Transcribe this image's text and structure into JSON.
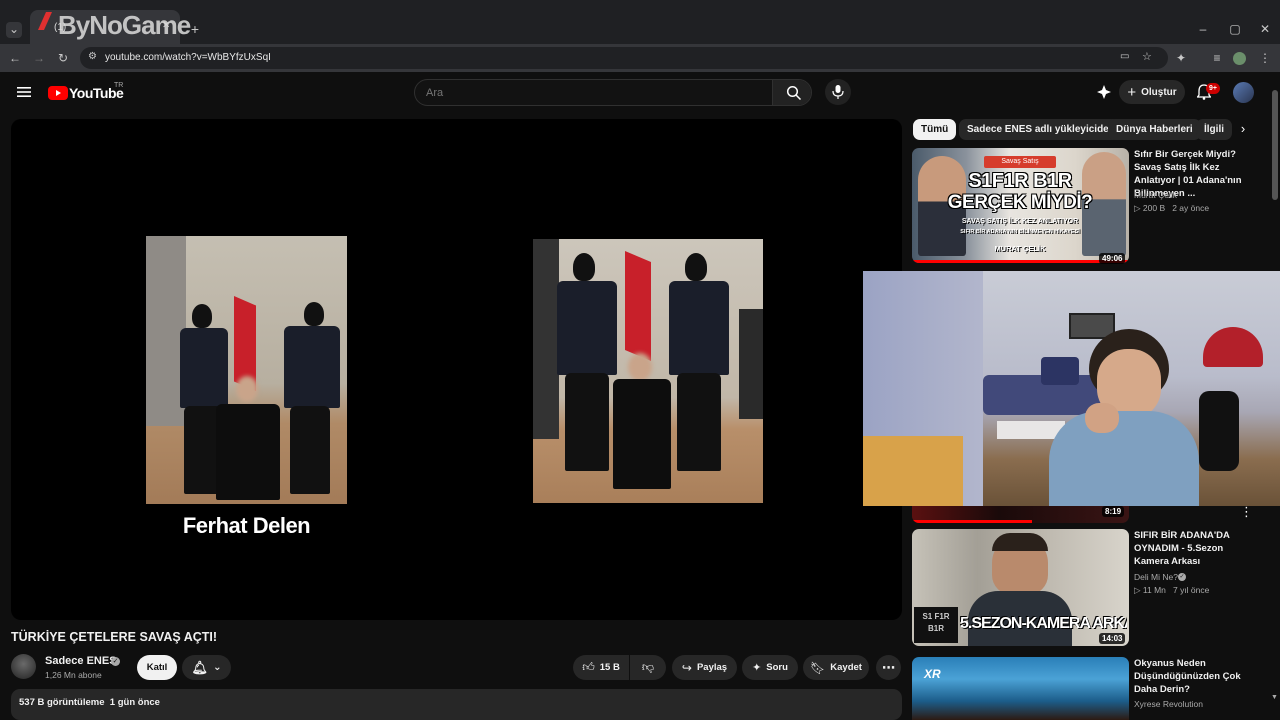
{
  "browser": {
    "watermark": "ByNoGame",
    "tab_title": "(1)",
    "url": "youtube.com/watch?v=WbBYfzUxSqI"
  },
  "header": {
    "logo_text": "YouTube",
    "country_code": "TR",
    "search_placeholder": "Ara",
    "create_label": "Oluştur",
    "notification_count": "9+"
  },
  "video": {
    "overlay_caption": "Ferhat Delen",
    "title": "TÜRKİYE ÇETELERE SAVAŞ AÇTI!",
    "channel_name": "Sadece ENES",
    "subscribers": "1,26 Mn abone",
    "join_label": "Katıl",
    "like_count": "15 B",
    "share_label": "Paylaş",
    "ask_label": "Soru",
    "save_label": "Kaydet",
    "description_stats": "537 B görüntüleme  1 gün önce"
  },
  "chips": [
    "Tümü",
    "Sadece ENES adlı yükleyiciden",
    "Dünya Haberleri",
    "İlgili"
  ],
  "recommendations": [
    {
      "title": "Sıfır Bir Gerçek Miydi? Savaş Satış İlk Kez Anlatıyor | 01 Adana'nın Bilinmeyen ...",
      "channel": "Murat Çelik",
      "meta": "▷ 200 B   2 ay önce",
      "duration": "49:06",
      "thumb_top": "Savaş Satış",
      "thumb_line1": "S1F1R B1R",
      "thumb_line2": "GERÇEK MİYDİ?",
      "thumb_line3": "SAVAŞ SATIŞ İLK KEZ ANLATIYOR",
      "thumb_line4": "SIFIR BİR ADANA'NIN BİLİNMEYEN HİKAYESİ",
      "thumb_name": "MURAT ÇELİK"
    },
    {
      "duration": "8:19"
    },
    {
      "title": "SIFIR BİR ADANA'DA OYNADIM - 5.Sezon Kamera Arkası",
      "channel": "Deli Mi Ne?",
      "meta": "▷ 11 Mn   7 yıl önce",
      "duration": "14:03",
      "thumb_text": "5.SEZON-KAMERA ARKASI",
      "thumb_logo": "S1 F1R B1R"
    },
    {
      "title": "Okyanus Neden Düşündüğünüzden Çok Daha Derin?",
      "channel": "Xyrese Revolution",
      "thumb_logo": "XR"
    }
  ],
  "colors": {
    "youtube_red": "#ff0000",
    "background": "#0f0f0f",
    "surface": "#272727",
    "notification_badge": "#cc0000"
  }
}
